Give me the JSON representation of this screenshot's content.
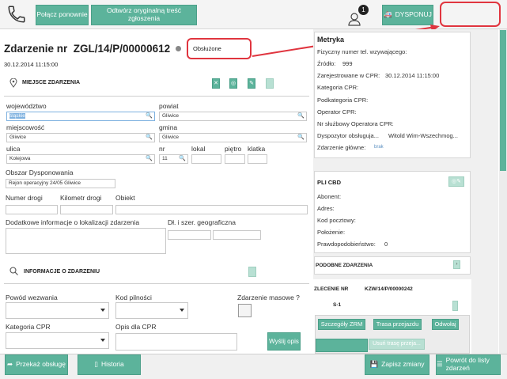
{
  "colors": {
    "accent": "#5cb39b",
    "annotation": "#e0353f"
  },
  "toolbar": {
    "phone_icon": "phone-icon",
    "reconnect": "Połącz ponownie",
    "open_original": "Odtwórz oryginalną treść zgłoszenia",
    "notification_count": "1",
    "dispatch": "DYSPONUJ"
  },
  "incident": {
    "title": "Zdarzenie nr  ZGL/14/P/00000612",
    "status": "Obsłużone",
    "datetime": "30.12.2014 11:15:00"
  },
  "location": {
    "section": "MIEJSCE ZDARZENIA",
    "labels": {
      "voivodeship": "województwo",
      "county": "powiat",
      "town": "miejscowość",
      "commune": "gmina",
      "street": "ulica",
      "number": "nr",
      "apartment": "lokal",
      "floor": "piętro",
      "staircase": "klatka",
      "area": "Obszar Dysponowania",
      "road_no": "Numer drogi",
      "km": "Kilometr drogi",
      "object": "Obiekt",
      "extra": "Dodatkowe informacje o lokalizacji zdarzenia",
      "geo": "Dł. i szer. geograficzna"
    },
    "values": {
      "voivodeship": "śląskie",
      "county": "Gliwice",
      "town": "Gliwice",
      "commune": "Gliwice",
      "street": "Kolejowa",
      "number": "11",
      "area": "Rejon operacyjny 24/05 Gliwice"
    }
  },
  "info": {
    "section": "INFORMACJE O ZDARZENIU",
    "reason": "Powód wezwania",
    "urgency": "Kod pilności",
    "mass": "Zdarzenie masowe ?",
    "cpr_category": "Kategoria CPR",
    "cpr_desc": "Opis dla CPR",
    "send_desc": "Wyślij opis"
  },
  "metrics": {
    "title": "Metryka",
    "phone": "Fizyczny numer tel. wzywającego:",
    "source_label": "Źródło:",
    "source": "999",
    "registered_label": "Zarejestrowane w CPR:",
    "registered": "30.12.2014 11:15:00",
    "category": "Kategoria CPR:",
    "subcategory": "Podkategoria CPR:",
    "operator": "Operator CPR:",
    "operator_no": "Nr służbowy Operatora CPR:",
    "dispatcher_label": "Dyspozytor obsługuja...",
    "dispatcher": "Witold Wim-Wszechmog...",
    "main_label": "Zdarzenie główne:",
    "main_value": "brak"
  },
  "pli": {
    "title": "PLI CBD",
    "subscriber": "Abonent:",
    "address": "Adres:",
    "postal": "Kod pocztowy:",
    "position": "Położenie:",
    "probability_label": "Prawdopodobieństwo:",
    "probability": "0"
  },
  "similar": {
    "title": "PODOBNE ZDARZENIA",
    "order_label": "ZLECENIE NR",
    "order_no": "KZW/14/P/00000242",
    "unit": "S-1",
    "zrm": "Szczegóły ZRM",
    "route": "Trasa przejazdu",
    "cancel": "Odwołaj",
    "remove_route": "Usuń trasę przeja..."
  },
  "bottom": {
    "handover": "Przekaż obsługę",
    "history": "Historia",
    "save": "Zapisz zmiany",
    "back": "Powrót do listy zdarzeń"
  }
}
